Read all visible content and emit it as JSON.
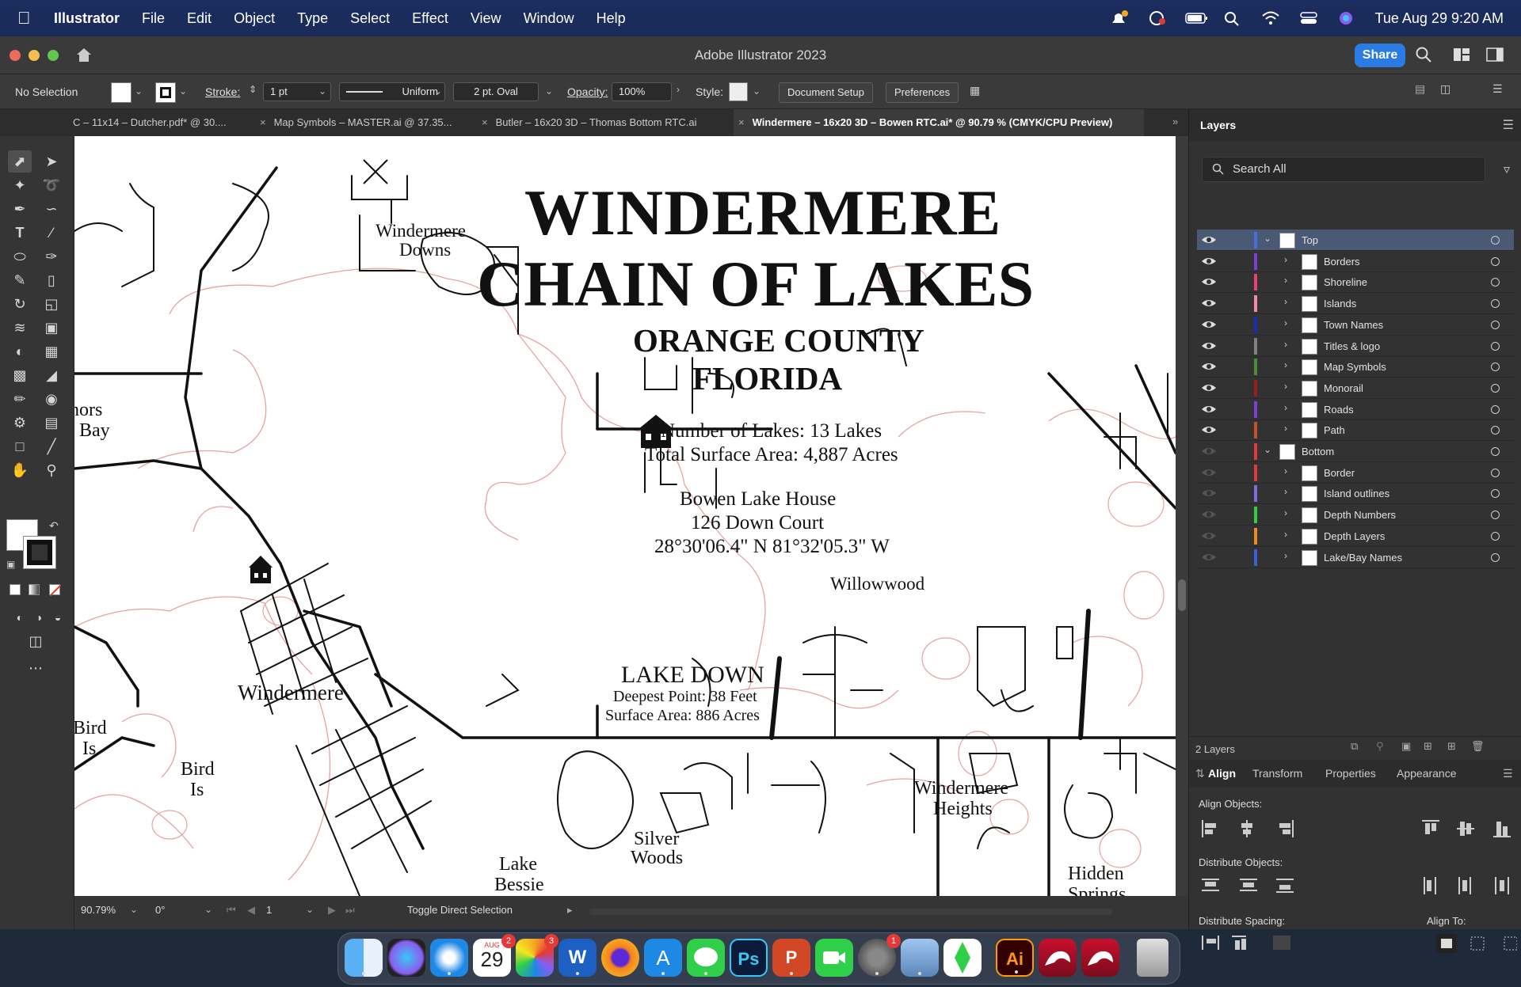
{
  "menubar": {
    "app_name": "Illustrator",
    "items": [
      "File",
      "Edit",
      "Object",
      "Type",
      "Select",
      "Effect",
      "View",
      "Window",
      "Help"
    ],
    "clock": "Tue Aug 29  9:20 AM"
  },
  "window": {
    "title": "Adobe Illustrator 2023",
    "share_label": "Share"
  },
  "controlbar": {
    "selection_label": "No Selection",
    "stroke_label": "Stroke:",
    "stroke_weight": "1 pt",
    "profile": "Uniform",
    "brush": "2 pt. Oval",
    "opacity_label": "Opacity:",
    "opacity_value": "100%",
    "style_label": "Style:",
    "document_setup": "Document Setup",
    "preferences": "Preferences"
  },
  "tabs": [
    {
      "label": "C – 11x14 – Dutcher.pdf* @ 30...."
    },
    {
      "label": "Map Symbols – MASTER.ai @ 37.35..."
    },
    {
      "label": "Butler – 16x20 3D – Thomas Bottom RTC.ai"
    },
    {
      "label": "Windermere – 16x20 3D – Bowen RTC.ai* @ 90.79 % (CMYK/CPU Preview)"
    }
  ],
  "map": {
    "title_line1": "WINDERMERE",
    "title_line2": "CHAIN OF LAKES",
    "subtitle_line1": "ORANGE COUNTY",
    "subtitle_line2": "FLORIDA",
    "stats_line1": "Number of Lakes: 13 Lakes",
    "stats_line2": "Total Surface Area: 4,887 Acres",
    "house_line1": "Bowen Lake House",
    "house_line2": "126 Down Court",
    "house_line3": "28°30'06.4\" N  81°32'05.3\" W",
    "labels": {
      "windermere_downs_1": "Windermere",
      "windermere_downs_2": "Downs",
      "willowwood": "Willowwood",
      "lake_down_name": "LAKE DOWN",
      "lake_down_depth": "Deepest Point: 38 Feet",
      "lake_down_area": "Surface Area: 886 Acres",
      "windermere": "Windermere",
      "butler_1": "nors",
      "butler_2": "Bay",
      "bird_is_left_1": "Bird",
      "bird_is_left_2": "Is",
      "bird_is_1": "Bird",
      "bird_is_2": "Is",
      "lake_bessie_1": "Lake",
      "lake_bessie_2": "Bessie",
      "silver_woods_1": "Silver",
      "silver_woods_2": "Woods",
      "windermere_heights_1": "Windermere",
      "windermere_heights_2": "Heights",
      "hidden_springs_1": "Hidden",
      "hidden_springs_2": "Springs"
    }
  },
  "statusbar": {
    "zoom": "90.79%",
    "rotation": "0°",
    "artboard": "1",
    "tool_hint": "Toggle Direct Selection"
  },
  "layers_panel": {
    "tab_label": "Layers",
    "search_placeholder": "Search All",
    "footer_count": "2 Layers",
    "layers": [
      {
        "name": "Top",
        "level": 0,
        "color": "#4a6fdc",
        "visible": true,
        "expanded": true
      },
      {
        "name": "Borders",
        "level": 1,
        "color": "#7a3fd6",
        "visible": true
      },
      {
        "name": "Shoreline",
        "level": 1,
        "color": "#e8407a",
        "visible": true
      },
      {
        "name": "Islands",
        "level": 1,
        "color": "#f08aa8",
        "visible": true
      },
      {
        "name": "Town Names",
        "level": 1,
        "color": "#1a2bb8",
        "visible": true
      },
      {
        "name": "Titles & logo",
        "level": 1,
        "color": "#808080",
        "visible": true
      },
      {
        "name": "Map Symbols",
        "level": 1,
        "color": "#4a8c3a",
        "visible": true
      },
      {
        "name": "Monorail",
        "level": 1,
        "color": "#a01c1c",
        "visible": true
      },
      {
        "name": "Roads",
        "level": 1,
        "color": "#7a3fd6",
        "visible": true
      },
      {
        "name": "Path",
        "level": 1,
        "color": "#c0532a",
        "visible": true
      },
      {
        "name": "Bottom",
        "level": 0,
        "color": "#e03a3a",
        "visible": false,
        "expanded": true
      },
      {
        "name": "Border",
        "level": 1,
        "color": "#e03a3a",
        "visible": false
      },
      {
        "name": "Island outlines",
        "level": 1,
        "color": "#7a6fdc",
        "visible": false
      },
      {
        "name": "Depth Numbers",
        "level": 1,
        "color": "#2fcf4a",
        "visible": false
      },
      {
        "name": "Depth Layers",
        "level": 1,
        "color": "#f08a1a",
        "visible": false
      },
      {
        "name": "Lake/Bay Names",
        "level": 1,
        "color": "#3a5fd6",
        "visible": false
      }
    ]
  },
  "align_panel": {
    "tabs": [
      "Align",
      "Transform",
      "Properties",
      "Appearance"
    ],
    "align_objects": "Align Objects:",
    "distribute_objects": "Distribute Objects:",
    "distribute_spacing": "Distribute Spacing:",
    "align_to": "Align To:"
  },
  "dock": {
    "calendar_month": "AUG",
    "calendar_day": "29",
    "apps": [
      "Finder",
      "Siri",
      "Safari",
      "Calendar",
      "Photos",
      "Word",
      "Firefox",
      "App Store",
      "Messages",
      "Photoshop",
      "PowerPoint",
      "FaceTime",
      "System Settings",
      "Preview",
      "Sims",
      "Illustrator",
      "App 1",
      "App 2",
      "Trash"
    ],
    "badges": {
      "calendar": "2",
      "photos": "3",
      "settings": "1"
    },
    "ps_label": "Ps",
    "ai_label": "Ai"
  }
}
